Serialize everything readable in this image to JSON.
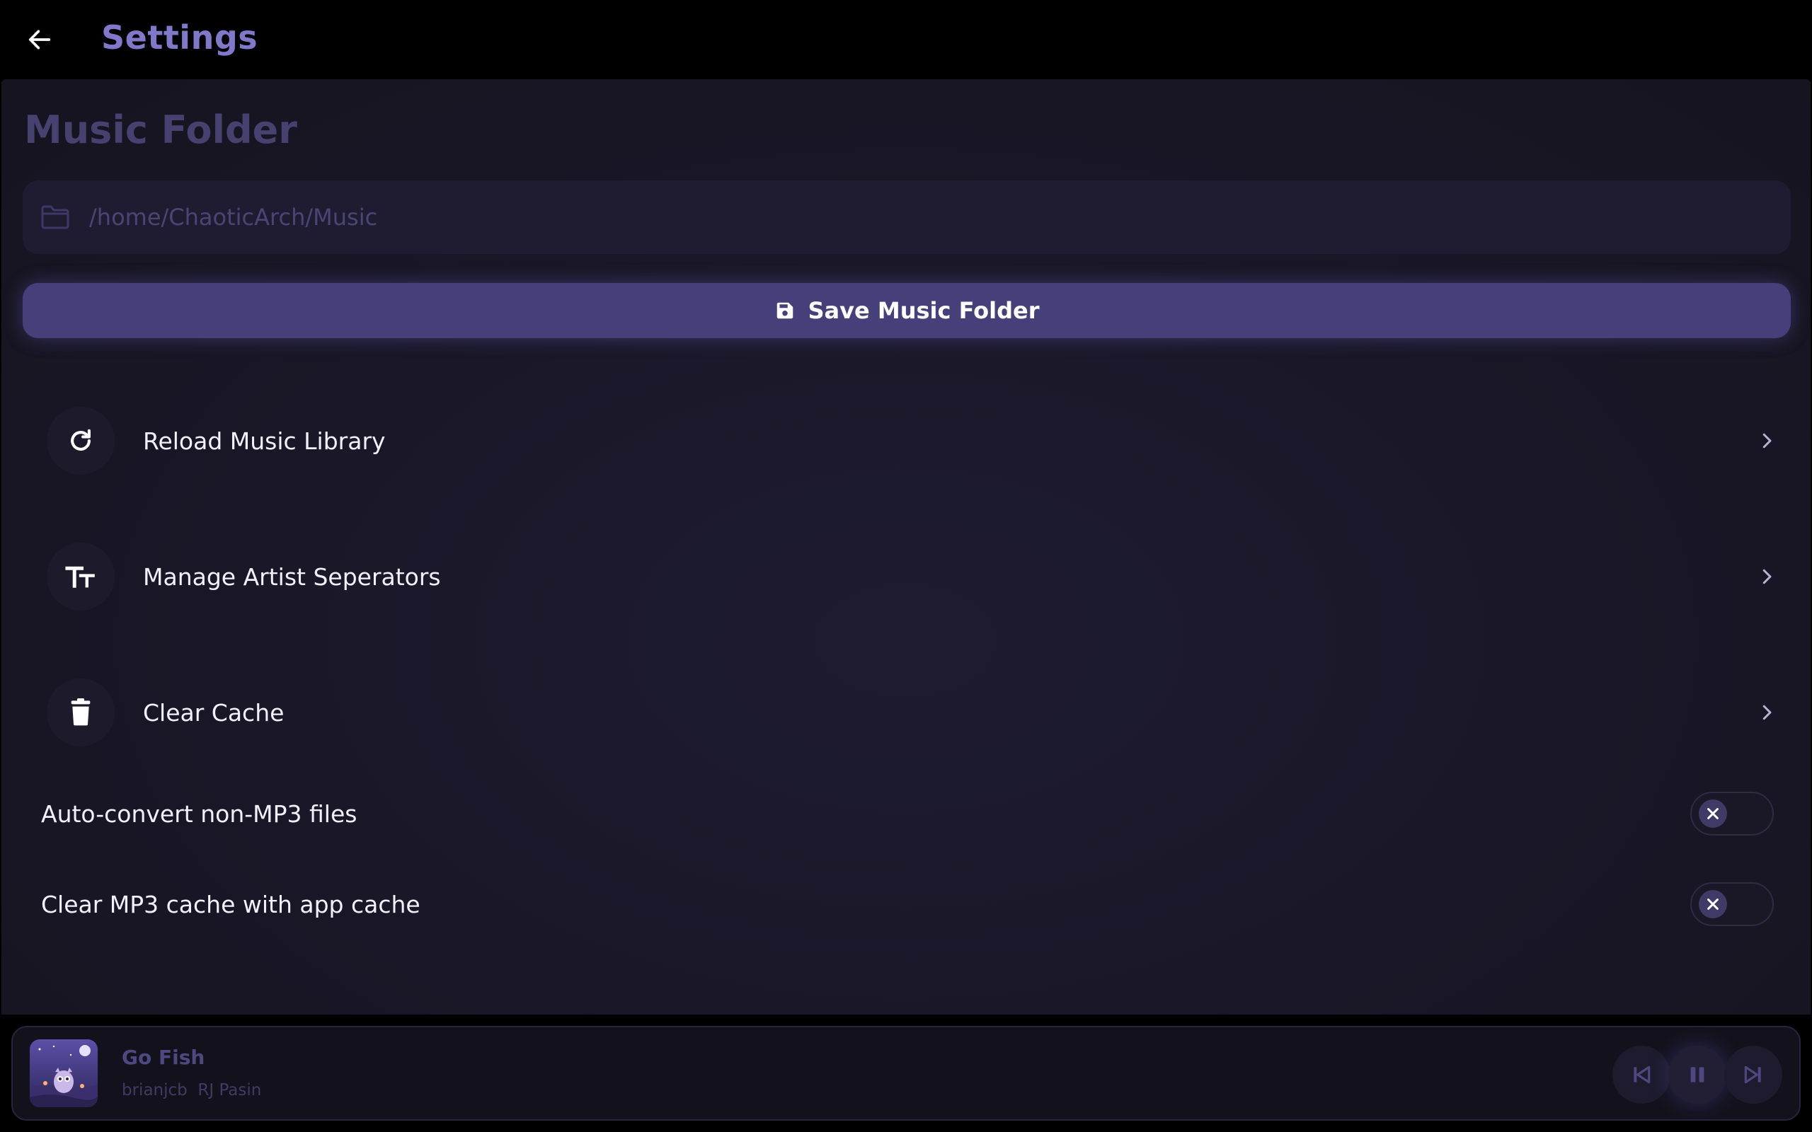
{
  "header": {
    "title": "Settings",
    "back_icon": "arrow-left-icon"
  },
  "music_folder": {
    "section_title": "Music Folder",
    "path_placeholder": "/home/ChaoticArch/Music",
    "path_value": "",
    "folder_icon": "folder-icon",
    "save_label": "Save Music Folder",
    "save_icon": "save-disk-icon"
  },
  "items": [
    {
      "label": "Reload Music Library",
      "icon": "refresh-icon"
    },
    {
      "label": "Manage Artist Seperators",
      "icon": "text-size-icon"
    },
    {
      "label": "Clear Cache",
      "icon": "trash-icon"
    }
  ],
  "toggles": [
    {
      "label": "Auto-convert non-MP3 files",
      "enabled": false
    },
    {
      "label": "Clear MP3 cache with app cache",
      "enabled": false
    }
  ],
  "player": {
    "title": "Go Fish",
    "artists": "brianjcb  RJ Pasin",
    "is_playing": true
  },
  "colors": {
    "accent": "#8078c8",
    "button": "#45407a",
    "background": "#191727"
  }
}
